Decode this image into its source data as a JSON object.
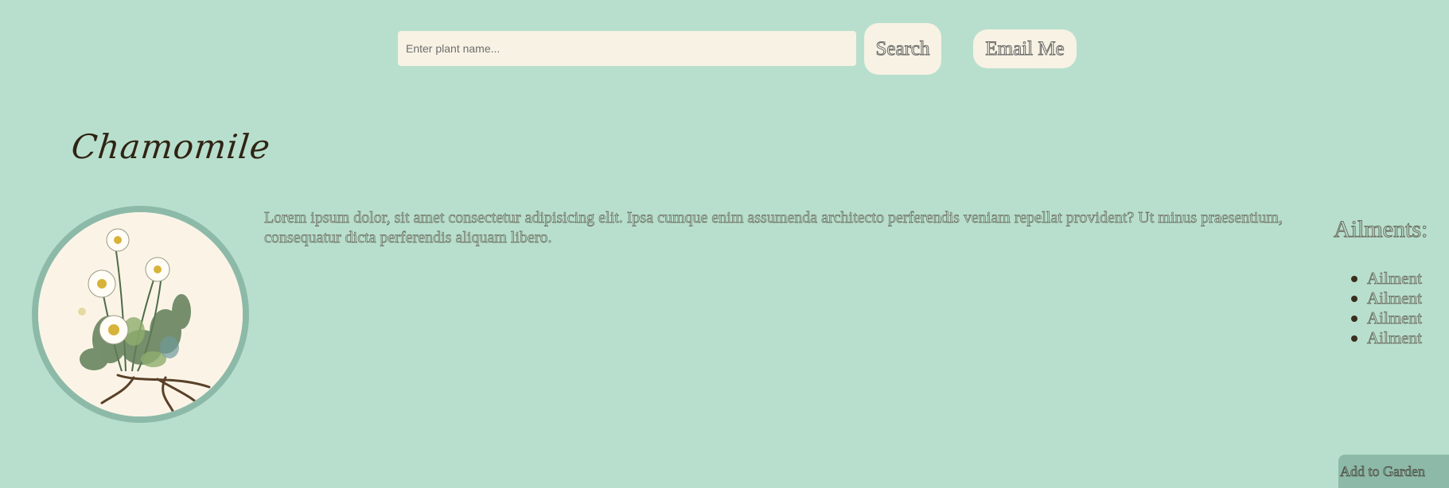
{
  "search": {
    "placeholder": "Enter plant name...",
    "button_label": "Search"
  },
  "header": {
    "email_label": "Email Me"
  },
  "plant": {
    "name": "Chamomile",
    "description": "Lorem ipsum dolor, sit amet consectetur adipisicing elit. Ipsa cumque enim assumenda architecto perferendis veniam repellat provident? Ut minus praesentium, consequatur dicta perferendis aliquam libero.",
    "image_icon": "chamomile-illustration"
  },
  "ailments": {
    "title": "Ailments:",
    "items": [
      "Ailment",
      "Ailment",
      "Ailment",
      "Ailment"
    ]
  },
  "actions": {
    "add_to_garden_label": "Add to Garden"
  },
  "colors": {
    "background": "#b8dfcd",
    "cream": "#f7f2e4",
    "accent_green": "#8dbaa8",
    "title_brown": "#2f2414"
  }
}
